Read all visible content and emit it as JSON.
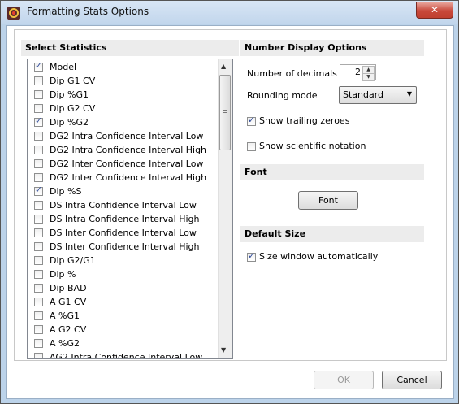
{
  "window": {
    "title": "Formatting Stats Options",
    "close_label": "✕"
  },
  "select_statistics": {
    "header": "Select Statistics",
    "items": [
      {
        "label": "Model",
        "checked": true
      },
      {
        "label": "Dip G1 CV",
        "checked": false
      },
      {
        "label": "Dip %G1",
        "checked": false
      },
      {
        "label": "Dip G2 CV",
        "checked": false
      },
      {
        "label": "Dip %G2",
        "checked": true
      },
      {
        "label": "DG2 Intra Confidence Interval Low",
        "checked": false
      },
      {
        "label": "DG2 Intra Confidence Interval High",
        "checked": false
      },
      {
        "label": "DG2 Inter Confidence Interval Low",
        "checked": false
      },
      {
        "label": "DG2 Inter Confidence Interval High",
        "checked": false
      },
      {
        "label": "Dip %S",
        "checked": true
      },
      {
        "label": "DS Intra Confidence Interval Low",
        "checked": false
      },
      {
        "label": "DS Intra Confidence Interval High",
        "checked": false
      },
      {
        "label": "DS Inter Confidence Interval Low",
        "checked": false
      },
      {
        "label": "DS Inter Confidence Interval High",
        "checked": false
      },
      {
        "label": "Dip G2/G1",
        "checked": false
      },
      {
        "label": "Dip %",
        "checked": false
      },
      {
        "label": "Dip BAD",
        "checked": false
      },
      {
        "label": "A G1 CV",
        "checked": false
      },
      {
        "label": "A %G1",
        "checked": false
      },
      {
        "label": "A G2 CV",
        "checked": false
      },
      {
        "label": "A %G2",
        "checked": false
      },
      {
        "label": "AG2 Intra Confidence Interval Low",
        "checked": false
      }
    ]
  },
  "number_display": {
    "header": "Number Display Options",
    "decimals_label": "Number of decimals",
    "decimals_value": "2",
    "rounding_label": "Rounding mode",
    "rounding_value": "Standard",
    "trailing_zeroes_label": "Show trailing zeroes",
    "trailing_zeroes_checked": true,
    "scientific_label": "Show scientific notation",
    "scientific_checked": false
  },
  "font": {
    "header": "Font",
    "button_label": "Font"
  },
  "default_size": {
    "header": "Default Size",
    "auto_label": "Size window automatically",
    "auto_checked": true
  },
  "footer": {
    "ok_label": "OK",
    "cancel_label": "Cancel"
  },
  "icons": {
    "app": "app-logo-icon",
    "scroll_up": "scroll-up-arrow-icon",
    "scroll_down": "scroll-down-arrow-icon",
    "dropdown": "chevron-down-icon"
  }
}
